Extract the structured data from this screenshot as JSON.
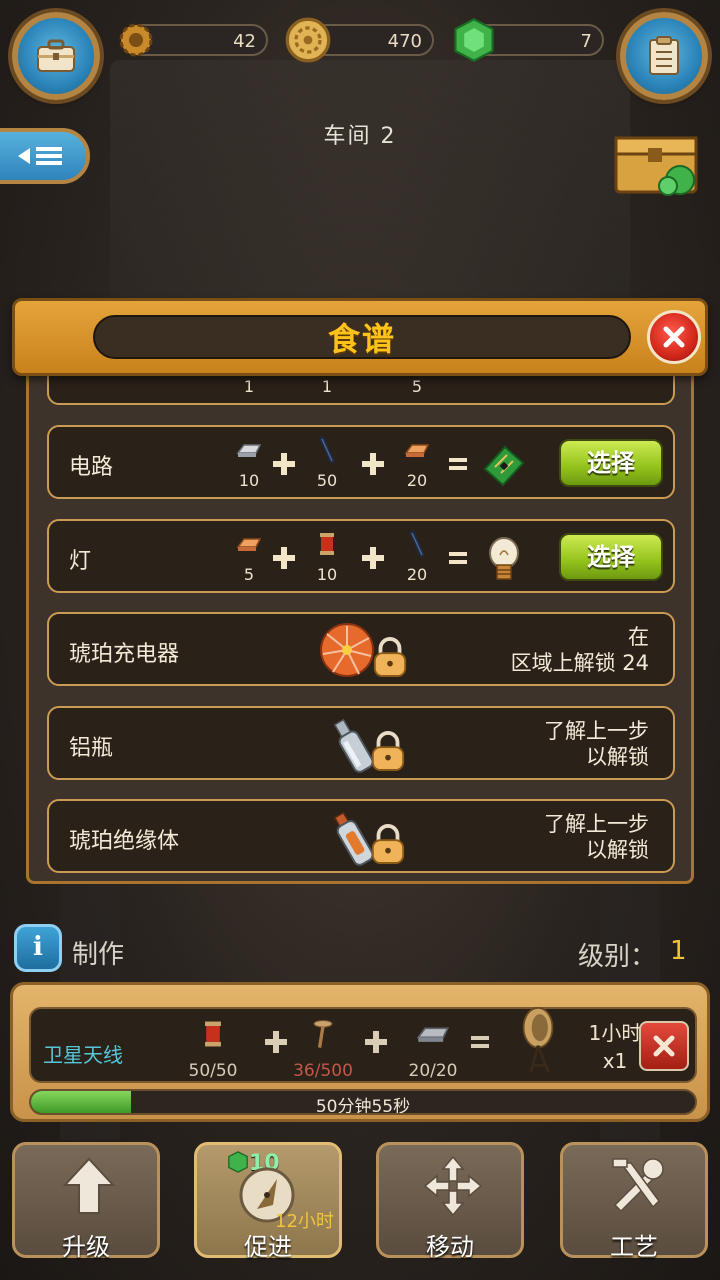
{
  "resources": {
    "gears": "42",
    "coins": "470",
    "gems": "7"
  },
  "workshop_title": "车间 2",
  "dialog": {
    "title": "食谱",
    "partial_row_quantities": [
      "1",
      "1",
      "5"
    ],
    "recipes": [
      {
        "name": "电路",
        "ingredients": [
          {
            "icon": "metal-ingot-icon",
            "qty": "10"
          },
          {
            "icon": "rod-icon",
            "qty": "50"
          },
          {
            "icon": "copper-ingot-icon",
            "qty": "20"
          }
        ],
        "product_icon": "circuit-board-icon",
        "button": "选择"
      },
      {
        "name": "灯",
        "ingredients": [
          {
            "icon": "copper-ingot-icon",
            "qty": "5"
          },
          {
            "icon": "spool-icon",
            "qty": "10"
          },
          {
            "icon": "rod-icon",
            "qty": "20"
          }
        ],
        "product_icon": "light-bulb-icon",
        "button": "选择"
      }
    ],
    "locked": [
      {
        "name": "琥珀充电器",
        "icon": "amber-fan-icon",
        "unlock_text": "在\n区域上解锁 24"
      },
      {
        "name": "铝瓶",
        "icon": "bottle-icon",
        "unlock_text": "了解上一步\n以解锁"
      },
      {
        "name": "琥珀绝缘体",
        "icon": "amber-bottle-icon",
        "unlock_text": "了解上一步\n以解锁"
      }
    ]
  },
  "crafting": {
    "label": "制作",
    "level_label": "级别：",
    "level": "1",
    "item_name": "卫星天线",
    "ingredients": [
      {
        "icon": "spool-icon",
        "qty": "50/50",
        "short": false
      },
      {
        "icon": "nail-icon",
        "qty": "36/500",
        "short": true
      },
      {
        "icon": "metal-ingot-icon",
        "qty": "20/20",
        "short": false
      }
    ],
    "product_icon": "satellite-dish-icon",
    "time": "1小时",
    "count": "x1",
    "progress_text": "50分钟55秒",
    "progress": 0.15
  },
  "nav": {
    "upgrade": "升级",
    "boost": "促进",
    "boost_count": "10",
    "boost_time": "12小时",
    "move": "移动",
    "craft": "工艺"
  },
  "colors": {
    "accent_orange": "#e5a43b",
    "title_yellow": "#ffc21a",
    "select_green": "#93c21c",
    "progress_green": "#3f9a2a",
    "short_red": "#c2584a"
  }
}
